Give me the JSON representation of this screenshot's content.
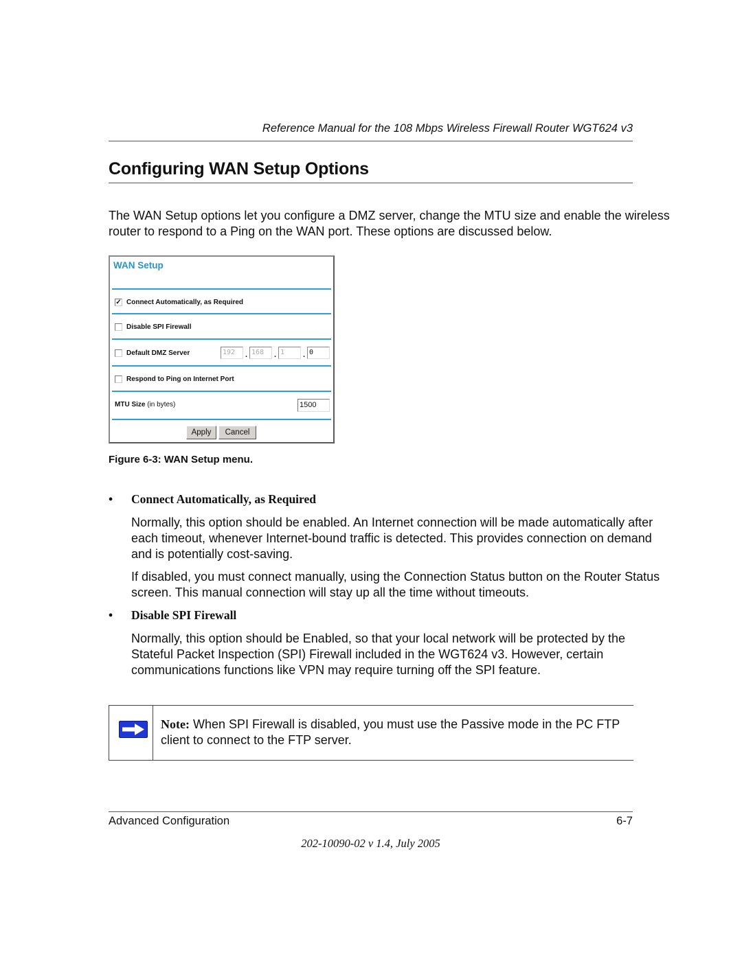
{
  "header": {
    "running_title": "Reference Manual for the 108 Mbps Wireless Firewall Router WGT624 v3"
  },
  "section": {
    "title": "Configuring WAN Setup Options",
    "intro": "The WAN Setup options let you configure a DMZ server, change the MTU size and enable the wireless router to respond to a Ping on the WAN port. These options are discussed below."
  },
  "wan_setup_panel": {
    "title": "WAN Setup",
    "options": [
      {
        "label": "Connect Automatically, as Required",
        "checked": true
      },
      {
        "label": "Disable SPI Firewall",
        "checked": false
      },
      {
        "label": "Default DMZ Server",
        "checked": false
      },
      {
        "label": "Respond to Ping on Internet Port",
        "checked": false
      }
    ],
    "dmz_ip": [
      "192",
      "168",
      "1",
      "0"
    ],
    "mtu_label": "MTU Size",
    "mtu_unit": "(in bytes)",
    "mtu_value": "1500",
    "apply_label": "Apply",
    "cancel_label": "Cancel",
    "accent_color": "#2aa0d8"
  },
  "figure_caption": "Figure 6-3:  WAN Setup menu.",
  "bullets": [
    {
      "heading": "Connect Automatically, as Required",
      "paragraphs": [
        "Normally, this option should be enabled. An Internet connection will be made automatically after each timeout, whenever Internet-bound traffic is detected. This provides connection on demand and is potentially cost-saving.",
        "If disabled, you must connect manually, using the Connection Status button on the Router Status screen. This manual connection will stay up all the time without timeouts."
      ]
    },
    {
      "heading": "Disable SPI Firewall",
      "paragraphs": [
        "Normally, this option should be Enabled, so that your local network will be protected by the Stateful Packet Inspection (SPI) Firewall included in the WGT624 v3. However, certain communications functions like VPN may require turning off the SPI feature."
      ]
    }
  ],
  "note": {
    "icon": "arrow-right-icon",
    "label": "Note:",
    "text": " When SPI Firewall is disabled, you must use the Passive mode in the PC FTP client to connect to the FTP server."
  },
  "footer": {
    "chapter": "Advanced Configuration",
    "page": "6-7",
    "doc_id": "202-10090-02 v 1.4, July 2005"
  }
}
